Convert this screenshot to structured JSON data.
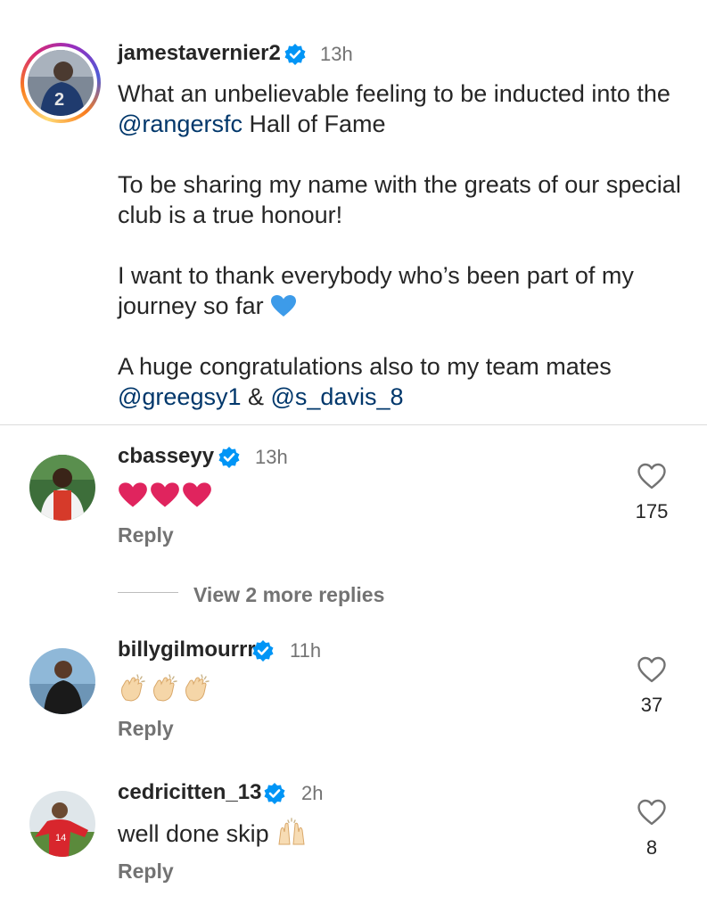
{
  "post": {
    "author": "jamestavernier2",
    "time": "13h",
    "paragraphs": [
      {
        "text": "What an unbelievable feeling to be inducted into the ",
        "mention": "@rangersfc",
        "after": " Hall of Fame"
      },
      {
        "text": "To be sharing my name with the greats of our special club is a true honour!"
      },
      {
        "text": "I want to thank everybody who’s been part of my journey so far "
      },
      {
        "text": "A huge congratulations also to my team mates ",
        "mention1": "@greegsy1",
        "amp": " & ",
        "mention2": "@s_davis_8"
      }
    ]
  },
  "comments": [
    {
      "username": "cbasseyy",
      "time": "13h",
      "likes": "175",
      "reply": "Reply",
      "emoji": "heart-emoji"
    },
    {
      "username": "billygilmourrr",
      "time": "11h",
      "likes": "37",
      "reply": "Reply",
      "emoji": "clapping-hands-emoji"
    },
    {
      "username": "cedricitten_13",
      "time": "2h",
      "text": "well done skip ",
      "likes": "8",
      "reply": "Reply",
      "emoji": "raising-hands-emoji"
    }
  ],
  "view_replies": "View 2 more replies",
  "colors": {
    "text": "#262626",
    "muted": "#737373",
    "link": "#00376b",
    "verified": "#0095f6",
    "heart_red": "#e0245e"
  }
}
